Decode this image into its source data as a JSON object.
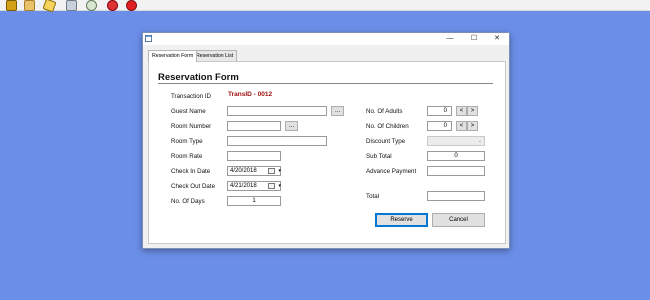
{
  "window": {
    "minimize_glyph": "—",
    "maximize_glyph": "☐",
    "close_glyph": "✕"
  },
  "taskbar": {
    "icons": [
      "app-icon",
      "folder-icon",
      "pencil-icon",
      "document-icon",
      "network-icon",
      "shield-icon",
      "close-circle-icon"
    ]
  },
  "tabs": [
    {
      "label": "Reservation Form",
      "active": true
    },
    {
      "label": "Reservation List",
      "active": false
    }
  ],
  "form": {
    "title": "Reservation Form",
    "transaction_id_label": "Transaction ID",
    "transaction_id_value": "TransID - 0012",
    "guest_name_label": "Guest Name",
    "guest_name_value": "",
    "guest_browse_label": "...",
    "room_number_label": "Room Number",
    "room_number_value": "",
    "room_browse_label": "...",
    "room_type_label": "Room Type",
    "room_type_value": "",
    "room_rate_label": "Room Rate",
    "room_rate_value": "",
    "check_in_label": "Check In Date",
    "check_in_value": "4/20/2018",
    "check_out_label": "Check Out Date",
    "check_out_value": "4/21/2018",
    "days_label": "No. Of Days",
    "days_value": "1",
    "adults_label": "No. Of Adults",
    "adults_value": "0",
    "children_label": "No. Of Children",
    "children_value": "0",
    "dec_label": "<",
    "inc_label": ">",
    "discount_label": "Discount Type",
    "discount_value": "",
    "subtotal_label": "Sub Total",
    "subtotal_value": "0",
    "advance_label": "Advance Payment",
    "advance_value": "",
    "total_label": "Total",
    "total_value": "",
    "reserve_label": "Reserve",
    "cancel_label": "Cancel"
  }
}
